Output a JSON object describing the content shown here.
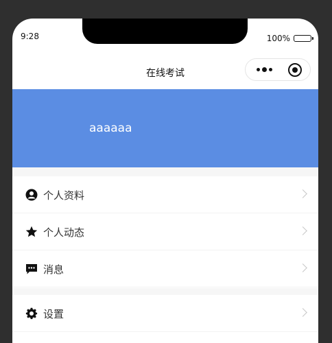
{
  "status_bar": {
    "time": "9:28",
    "battery": "100%"
  },
  "nav": {
    "title": "在线考试"
  },
  "profile": {
    "username": "aaaaaa"
  },
  "menu_group_1": [
    {
      "label": "个人资料",
      "icon": "user-circle-icon"
    },
    {
      "label": "个人动态",
      "icon": "star-icon"
    },
    {
      "label": "消息",
      "icon": "message-icon"
    }
  ],
  "menu_group_2": [
    {
      "label": "设置",
      "icon": "gear-icon"
    }
  ],
  "colors": {
    "header_bg": "#5b8de3",
    "background": "#2f2f2f"
  }
}
